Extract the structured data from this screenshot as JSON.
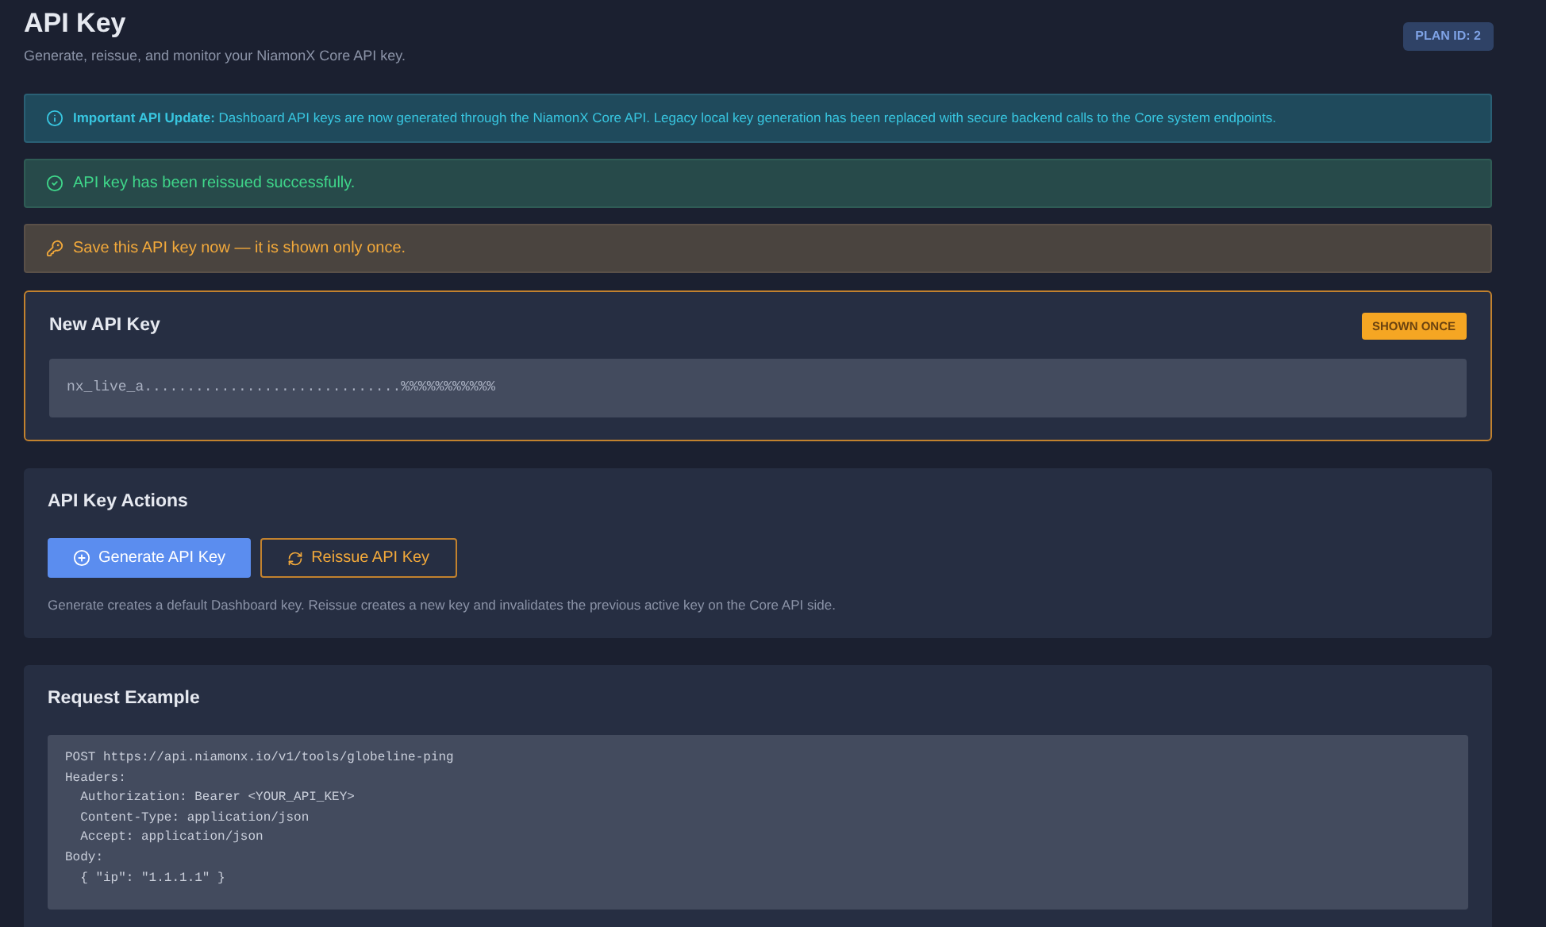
{
  "header": {
    "title": "API Key",
    "subtitle": "Generate, reissue, and monitor your NiamonX Core API key.",
    "badge": "PLAN ID: 2"
  },
  "alerts": [
    {
      "kind": "info",
      "text": "**Important API Update:** Dashboard API keys are now generated through the NiamonX Core API. Legacy local key generation has been replaced with secure backend calls to the Core system endpoints."
    },
    {
      "kind": "success",
      "text": "API key has been reissued successfully."
    },
    {
      "kind": "warning",
      "text": "Save this API key now — it is shown only once."
    }
  ],
  "new_key": {
    "title": "New API Key",
    "badge": "SHOWN ONCE",
    "value": "nx_live_a..............................%%%%%%%%%%%"
  },
  "actions": {
    "title": "API Key Actions",
    "buttons": [
      {
        "kind": "primary",
        "label": "Generate API Key"
      },
      {
        "kind": "outline",
        "label": "Reissue API Key"
      }
    ],
    "note": "Generate creates a default Dashboard key. Reissue creates a new key and invalidates the previous active key on the Core API side."
  },
  "request_example": {
    "title": "Request Example",
    "lines": [
      "POST https://api.niamonx.io/v1/tools/globeline-ping",
      "Headers:",
      "  Authorization: Bearer <YOUR_API_KEY>",
      "  Content-Type: application/json",
      "  Accept: application/json",
      "Body:",
      "  { \"ip\": \"1.1.1.1\" }"
    ]
  }
}
